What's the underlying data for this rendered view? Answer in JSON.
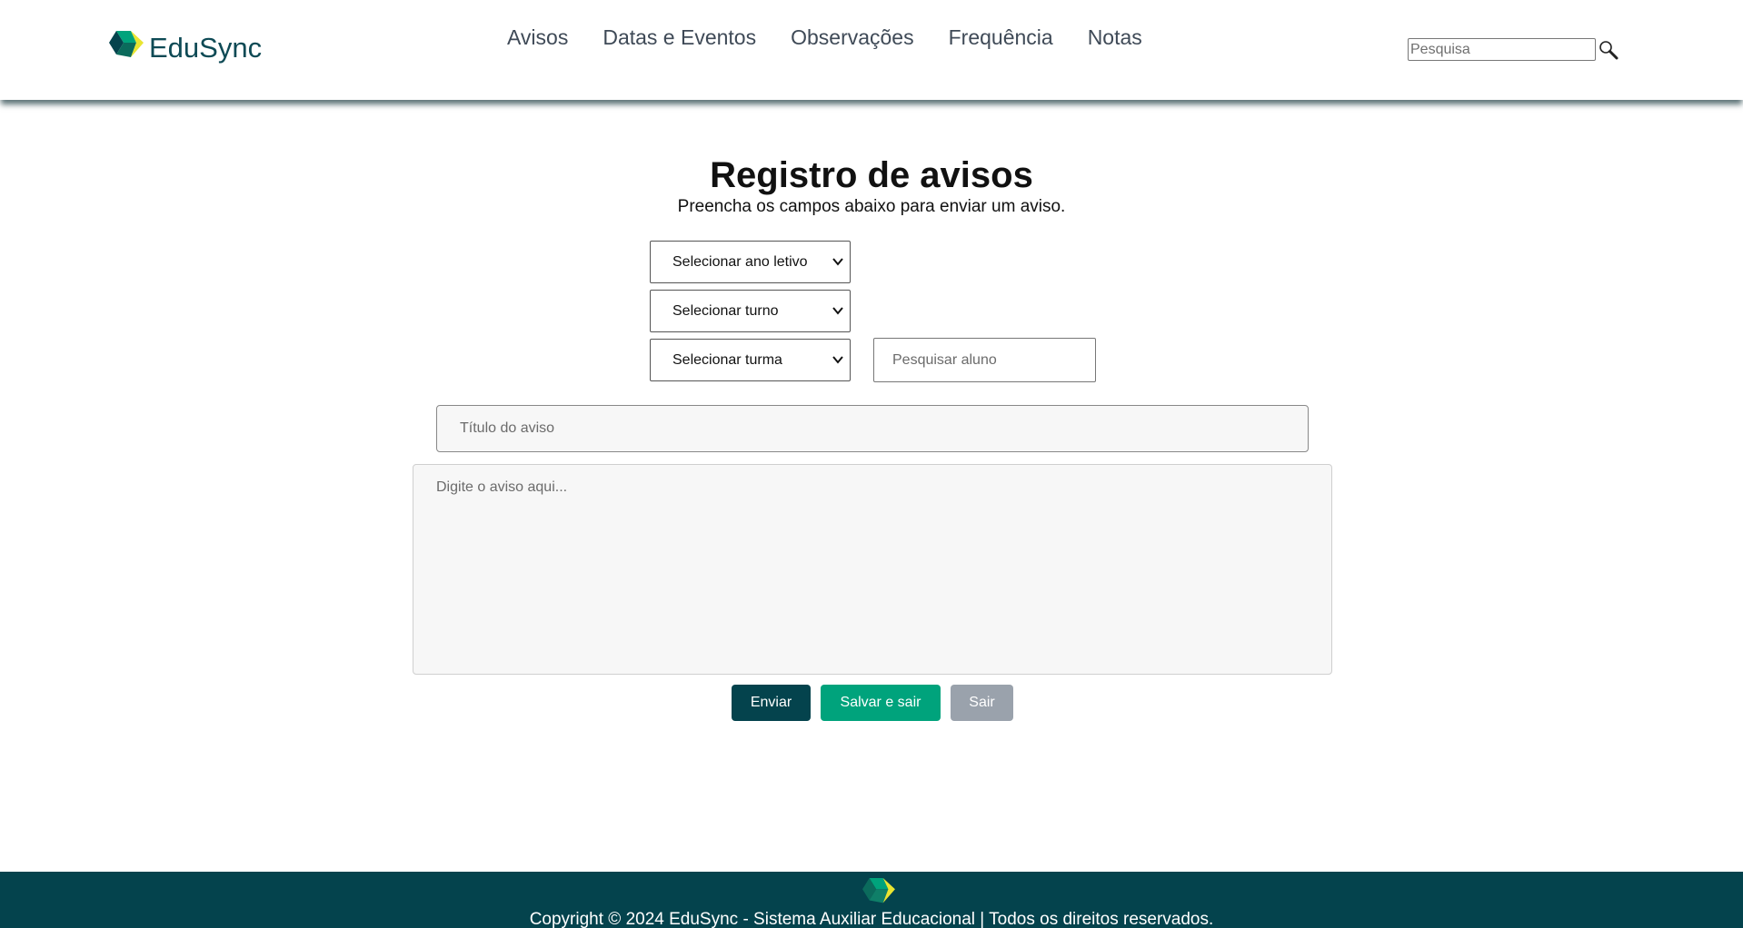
{
  "header": {
    "brand": "EduSync",
    "nav": [
      {
        "label": "Avisos"
      },
      {
        "label": "Datas e Eventos"
      },
      {
        "label": "Observações"
      },
      {
        "label": "Frequência"
      },
      {
        "label": "Notas"
      }
    ],
    "search": {
      "placeholder": "Pesquisa",
      "icon": "search-icon"
    }
  },
  "form": {
    "title": "Registro de avisos",
    "subtitle": "Preencha os campos abaixo para enviar um aviso.",
    "select_year": "Selecionar ano letivo",
    "select_shift": "Selecionar turno",
    "select_class": "Selecionar turma",
    "student_search_placeholder": "Pesquisar aluno",
    "notice_title_placeholder": "Título do aviso",
    "notice_body_placeholder": "Digite o aviso aqui...",
    "buttons": {
      "send": "Enviar",
      "save_exit": "Salvar e sair",
      "exit": "Sair"
    }
  },
  "footer": {
    "copyright": "Copyright © 2024 EduSync - Sistema Auxiliar Educacional | Todos os direitos reservados."
  },
  "colors": {
    "brand_dark": "#04434d",
    "brand_green": "#00a37c",
    "brand_yellow": "#e9e531",
    "muted_button": "#9aa2ac"
  }
}
